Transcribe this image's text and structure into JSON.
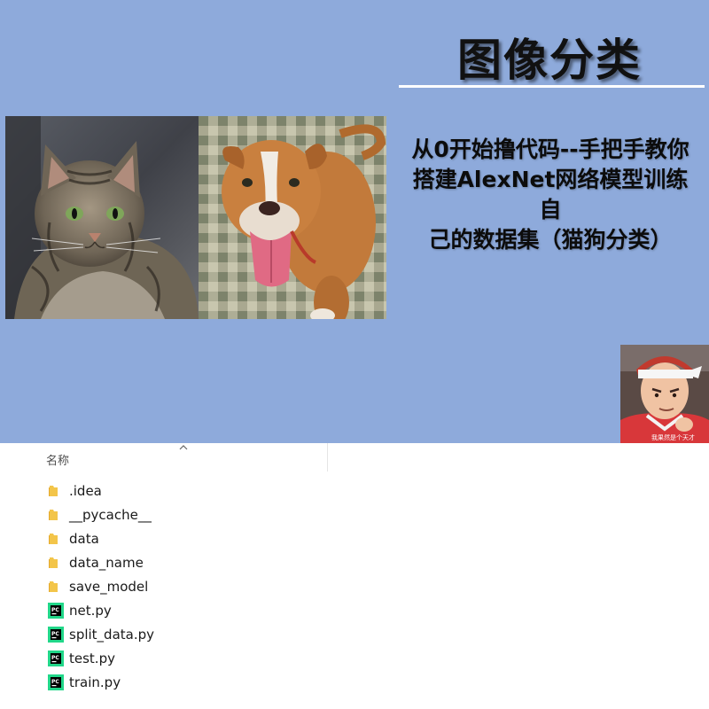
{
  "banner": {
    "title": "图像分类",
    "subtitle_lines": [
      "从0开始撸代码--手把手教你",
      "搭建AlexNet网络模型训练自",
      "己的数据集（猫狗分类）"
    ],
    "avatar_caption": "我果然是个天才"
  },
  "explorer": {
    "column_header": "名称",
    "files": [
      {
        "name": ".idea",
        "icon": "folder-icon"
      },
      {
        "name": "__pycache__",
        "icon": "folder-icon"
      },
      {
        "name": "data",
        "icon": "folder-icon"
      },
      {
        "name": "data_name",
        "icon": "folder-icon"
      },
      {
        "name": "save_model",
        "icon": "folder-icon"
      },
      {
        "name": "net.py",
        "icon": "pycharm-file-icon"
      },
      {
        "name": "split_data.py",
        "icon": "pycharm-file-icon"
      },
      {
        "name": "test.py",
        "icon": "pycharm-file-icon"
      },
      {
        "name": "train.py",
        "icon": "pycharm-file-icon"
      }
    ]
  },
  "colors": {
    "banner_bg": "#8eaadb",
    "folder": "#f3c54a",
    "pycharm_green": "#21d789"
  }
}
